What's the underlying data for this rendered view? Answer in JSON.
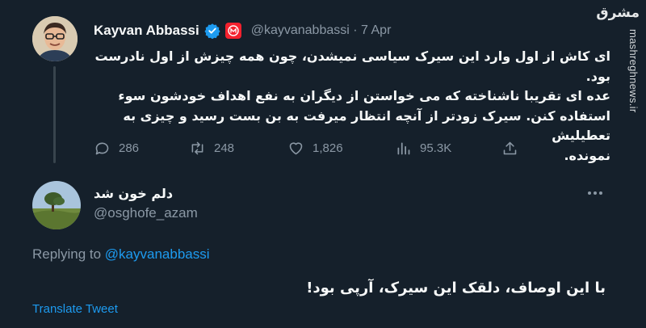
{
  "brand": {
    "word": "مشرق",
    "site": "mashreghnews.ir"
  },
  "main_tweet": {
    "author_name": "Kayvan Abbassi",
    "handle": "@kayvanabbassi",
    "separator": "·",
    "date": "7 Apr",
    "text_lines": [
      "ای کاش از اول وارد این سیرک سیاسی نمیشدن، چون همه چیزش از اول نادرست بود.",
      "عده ای تقریبا ناشناخته که می خواستن از دیگران به نفع اهداف خودشون سوء",
      "استفاده کنن. سیرک زودتر از آنچه انتظار میرفت به بن بست رسید و چیزی به تعطیلیش",
      "نمونده."
    ],
    "stats": {
      "replies": "286",
      "retweets": "248",
      "likes": "1,826",
      "views": "95.3K"
    }
  },
  "reply": {
    "author_name": "دلم خون شد",
    "handle": "@osghofe_azam",
    "replying_prefix": "Replying to",
    "replying_to": "@kayvanabbassi",
    "text": "با این اوصاف، دلقک این سیرک، آرپی بود!",
    "translate_label": "Translate Tweet"
  },
  "colors": {
    "background": "#15202b",
    "accent": "#1d9bf0",
    "muted": "#8b98a5",
    "verified": "#1d9bf0",
    "badge": "#f4212e"
  },
  "icons": [
    "verified-icon",
    "badge-m-icon",
    "reply-icon",
    "retweet-icon",
    "like-icon",
    "views-icon",
    "share-icon",
    "more-icon"
  ]
}
